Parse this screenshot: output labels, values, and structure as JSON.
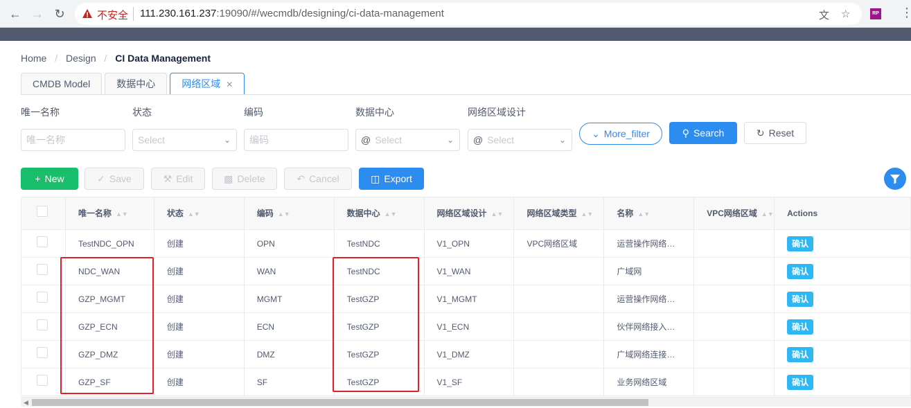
{
  "browser": {
    "insecure_label": "不安全",
    "url_host": "111.230.161.237",
    "url_rest": ":19090/#/wecmdb/designing/ci-data-management"
  },
  "breadcrumb": [
    "Home",
    "Design",
    "CI Data Management"
  ],
  "tabs": [
    {
      "label": "CMDB Model"
    },
    {
      "label": "数据中心"
    },
    {
      "label": "网络区域",
      "active": true
    }
  ],
  "filters": {
    "labels": [
      "唯一名称",
      "状态",
      "编码",
      "数据中心",
      "网络区域设计"
    ],
    "unique_name_placeholder": "唯一名称",
    "status_placeholder": "Select",
    "code_placeholder": "编码",
    "datacenter_placeholder": "Select",
    "zone_design_placeholder": "Select",
    "more_filter": "More_filter",
    "search": "Search",
    "reset": "Reset"
  },
  "toolbar": {
    "new": "New",
    "save": "Save",
    "edit": "Edit",
    "delete": "Delete",
    "cancel": "Cancel",
    "export": "Export"
  },
  "table": {
    "columns": [
      "唯一名称",
      "状态",
      "编码",
      "数据中心",
      "网络区域设计",
      "网络区域类型",
      "名称",
      "VPC网络区域",
      "Actions"
    ],
    "rows": [
      [
        "TestNDC_OPN",
        "创建",
        "OPN",
        "TestNDC",
        "V1_OPN",
        "VPC网络区域",
        "运营操作网络…",
        "",
        "确认"
      ],
      [
        "NDC_WAN",
        "创建",
        "WAN",
        "TestNDC",
        "V1_WAN",
        "",
        "广域网",
        "",
        "确认"
      ],
      [
        "GZP_MGMT",
        "创建",
        "MGMT",
        "TestGZP",
        "V1_MGMT",
        "",
        "运营操作网络…",
        "",
        "确认"
      ],
      [
        "GZP_ECN",
        "创建",
        "ECN",
        "TestGZP",
        "V1_ECN",
        "",
        "伙伴网络接入…",
        "",
        "确认"
      ],
      [
        "GZP_DMZ",
        "创建",
        "DMZ",
        "TestGZP",
        "V1_DMZ",
        "",
        "广域网络连接…",
        "",
        "确认"
      ],
      [
        "GZP_SF",
        "创建",
        "SF",
        "TestGZP",
        "V1_SF",
        "",
        "业务网络区域",
        "",
        "确认"
      ]
    ]
  },
  "colors": {
    "primary": "#2d8cf0",
    "success": "#19be6b",
    "info": "#2db7f5",
    "annotation": "#e0202a"
  }
}
